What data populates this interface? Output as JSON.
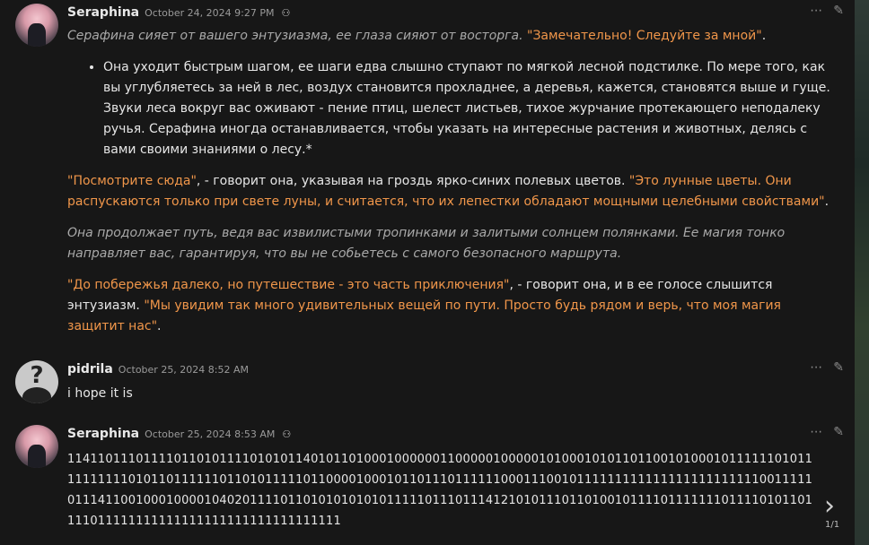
{
  "messages": [
    {
      "author": "Seraphina",
      "time": "October 24, 2024 9:27 PM",
      "lines": {
        "p1_italic": "Серафина сияет от вашего энтузиазма, ее глаза сияют от восторга. ",
        "p1_quote": "\"Замечательно! Следуйте за мной\"",
        "p1_end": ".",
        "li1": "Она уходит быстрым шагом, ее шаги едва слышно ступают по мягкой лесной подстилке. По мере того, как вы углубляетесь за ней в лес, воздух становится прохладнее, а деревья, кажется, становятся выше и гуще. Звуки леса вокруг вас оживают - пение птиц, шелест листьев, тихое журчание протекающего неподалеку ручья. Серафина иногда останавливается, чтобы указать на интересные растения и животных, делясь с вами своими знаниями о лесу.*",
        "p2_q1": "\"Посмотрите сюда\"",
        "p2_mid": ", - говорит она, указывая на гроздь ярко-синих полевых цветов. ",
        "p2_q2": "\"Это лунные цветы. Они распускаются только при свете луны, и считается, что их лепестки обладают мощными целебными свойствами\"",
        "p2_end": ".",
        "p3_italic": "Она продолжает путь, ведя вас извилистыми тропинками и залитыми солнцем полянками. Ее магия тонко направляет вас, гарантируя, что вы не собьетесь с самого безопасного маршрута.",
        "p4_q1": "\"До побережья далеко, но путешествие - это часть приключения\"",
        "p4_mid": ", - говорит она, и в ее голосе слышится энтузиазм. ",
        "p4_q2": "\"Мы увидим так много удивительных вещей по пути. Просто будь рядом и верь, что моя магия защитит нас\"",
        "p4_end": "."
      }
    },
    {
      "author": "pidrila",
      "time": "October 25, 2024 8:52 AM",
      "text": "i hope it is"
    },
    {
      "author": "Seraphina",
      "time": "October 25, 2024 8:53 AM",
      "text": "114110111011110110101111010101140101101000100000011000001000001010001010110110010100010111111010111111111101011011111101101011111011000010001011011101111110001110010111111111111111111111111001111101114110010001000010402011110110101010101011111011101114121010111011010010111101111111011110101101111011111111111111111111111111111111"
    }
  ],
  "icons": {
    "more": "more-horizontal-icon",
    "edit": "pencil-icon",
    "bot": "bot-icon",
    "next": "chevron-right-icon"
  },
  "pager": {
    "label": "1/1",
    "next": "›"
  },
  "glyphs": {
    "more": "⋯",
    "edit": "✎",
    "bot": "⚇"
  }
}
